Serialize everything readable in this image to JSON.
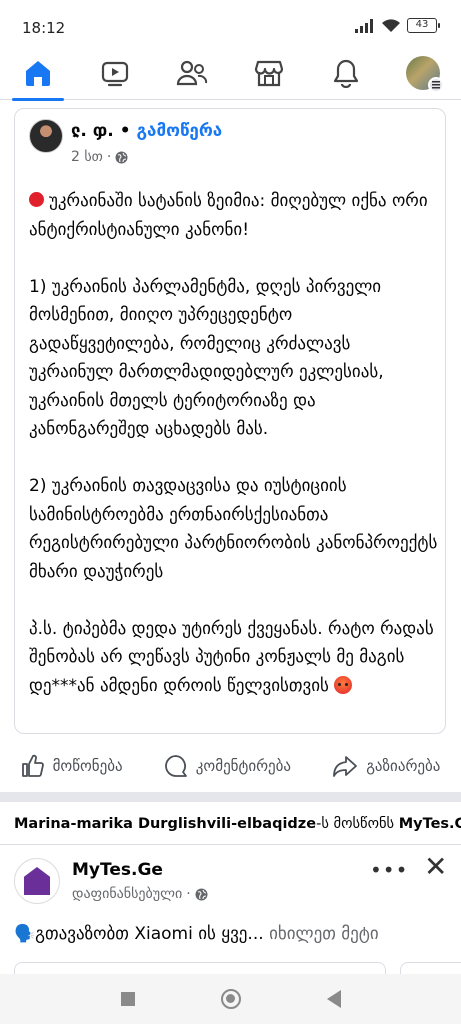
{
  "status_bar": {
    "time": "18:12",
    "battery": "43"
  },
  "nav": {
    "items": [
      {
        "name": "home",
        "active": true
      },
      {
        "name": "watch",
        "active": false
      },
      {
        "name": "friends",
        "active": false
      },
      {
        "name": "marketplace",
        "active": false
      },
      {
        "name": "notifications",
        "active": false
      },
      {
        "name": "profile-menu",
        "active": false
      }
    ],
    "accent": "#1877f2"
  },
  "post": {
    "author": "ჺ. ჶ.",
    "separator": "•",
    "follow": "გამოწერა",
    "time": "2 სთ",
    "dot": "·",
    "title_line": "უკრაინაში სატანის ზეიმია: მიღებულ იქნა ორი ანტიქრისტიანული კანონი!",
    "paragraph_1": "1) უკრაინის პარლამენტმა, დღეს პირველი მოსმენით, მიიღო უპრეცედენტო გადაწყვეტილება, რომელიც კრძალავს უკრაინულ მართლმადიდებლურ ეკლესიას, უკრაინის მთელს ტერიტორიაზე და კანონგარეშედ აცხადებს მას.",
    "paragraph_2": "2) უკრაინის თავდაცვისა და იუსტიციის სამინისტროებმა ერთნაირსქესიანთა რეგისტრირებული პარტნიორობის კანონპროექტს მხარი დაუჭირეს",
    "paragraph_3": "პ.ს. ტიპებმა დედა უტირეს ქვეყანას. რატო რადას შენობას არ ლეწავს პუტინი კონჟალს მე მაგის დე***ან ამდენი დროის წელვისთვის"
  },
  "actions": {
    "like": "მოწონება",
    "comment": "კომენტირება",
    "share": "გაზიარება"
  },
  "liked_by": {
    "user": "Marina-marika Durglishvili-elbaqidze",
    "suffix": "-ს მოსწონს",
    "page": "MyTes.Ge",
    "end": "."
  },
  "ad": {
    "name": "MyTes.Ge",
    "sponsored": "დაფინანსებული",
    "dot": "·",
    "text": "🗣️გთავაზობთ  Xiaomi ის ყვე...",
    "more": "იხილეთ მეტი"
  }
}
